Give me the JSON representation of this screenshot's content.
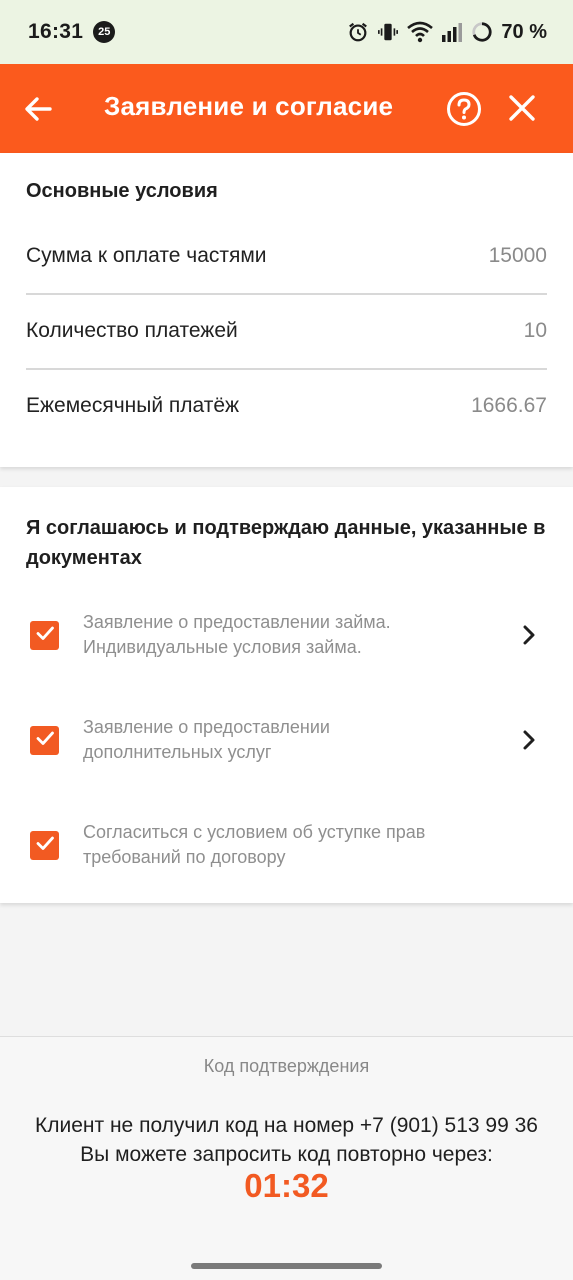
{
  "status_bar": {
    "time": "16:31",
    "notification_badge": "25",
    "battery": "70 %",
    "icons": [
      "alarm-icon",
      "vibrate-icon",
      "wifi-icon",
      "signal-icon",
      "battery-ring-icon"
    ]
  },
  "app_bar": {
    "title": "Заявление и согласие",
    "back_icon": "arrow-left-icon",
    "help_icon": "question-circle-icon",
    "close_icon": "close-icon",
    "color": "#fb5a1d"
  },
  "conditions": {
    "title": "Основные условия",
    "rows": [
      {
        "label": "Сумма к оплате частями",
        "value": "15000"
      },
      {
        "label": "Количество платежей",
        "value": "10"
      },
      {
        "label": "Ежемесячный платёж",
        "value": "1666.67"
      }
    ]
  },
  "agreement": {
    "title": "Я соглашаюсь и подтверждаю данные, указанные в документах",
    "items": [
      {
        "line1": "Заявление о предоставлении займа.",
        "line2": "Индивидуальные условия займа.",
        "checked": true,
        "has_chevron": true
      },
      {
        "line1": "Заявление о предоставлении",
        "line2": "дополнительных услуг",
        "checked": true,
        "has_chevron": true
      },
      {
        "line1": "Согласиться с условием об уступке прав",
        "line2": "требований по договору",
        "checked": true,
        "has_chevron": false
      }
    ],
    "accent_color": "#f25a22"
  },
  "confirmation": {
    "label": "Код подтверждения",
    "message_line1": "Клиент не получил код на номер +7 (901) 513 99 36",
    "message_line2": "Вы можете запросить код повторно через:",
    "timer": "01:32"
  }
}
